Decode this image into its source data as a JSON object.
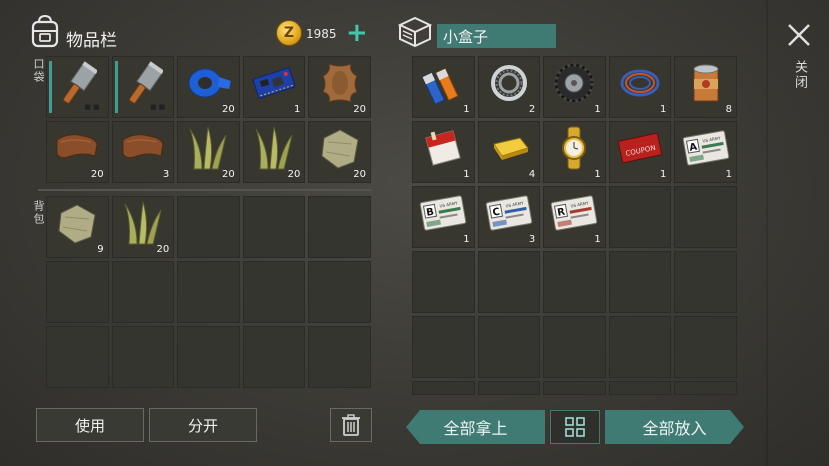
{
  "inventory": {
    "title": "物品栏",
    "coin_symbol": "Z",
    "coins": "1985",
    "add_symbol": "+",
    "pocket_label": "口袋",
    "backpack_label": "背包",
    "pocket": [
      {
        "item": "cleaver-icon",
        "count": "",
        "selected": true
      },
      {
        "item": "cleaver-icon",
        "count": "",
        "selected": true
      },
      {
        "item": "duct-tape-icon",
        "count": "20"
      },
      {
        "item": "circuit-board-icon",
        "count": "1"
      },
      {
        "item": "animal-hide-icon",
        "count": "20"
      },
      {
        "item": "leather-icon",
        "count": "20"
      },
      {
        "item": "leather-icon",
        "count": "3"
      },
      {
        "item": "plant-fiber-icon",
        "count": "20"
      },
      {
        "item": "plant-fiber-icon",
        "count": "20"
      },
      {
        "item": "cloth-icon",
        "count": "20"
      }
    ],
    "backpack": [
      {
        "item": "cloth-icon",
        "count": "9"
      },
      {
        "item": "plant-fiber-icon",
        "count": "20"
      },
      {},
      {},
      {},
      {},
      {},
      {},
      {},
      {},
      {},
      {},
      {},
      {},
      {}
    ],
    "use_label": "使用",
    "split_label": "分开"
  },
  "container": {
    "title": "小盒子",
    "slots": [
      {
        "item": "batteries-icon",
        "count": "1"
      },
      {
        "item": "bearing-icon",
        "count": "2"
      },
      {
        "item": "tire-icon",
        "count": "1"
      },
      {
        "item": "wire-coil-icon",
        "count": "1"
      },
      {
        "item": "tin-can-icon",
        "count": "8"
      },
      {
        "item": "cigarettes-icon",
        "count": "1"
      },
      {
        "item": "gold-bar-icon",
        "count": "4"
      },
      {
        "item": "gold-watch-icon",
        "count": "1"
      },
      {
        "item": "coupon-icon",
        "count": "1"
      },
      {
        "item": "army-card-a-icon",
        "count": "1"
      },
      {
        "item": "army-card-b-icon",
        "count": "1"
      },
      {
        "item": "army-card-c-icon",
        "count": "3"
      },
      {
        "item": "army-card-r-icon",
        "count": "1"
      },
      {},
      {},
      {},
      {},
      {},
      {},
      {},
      {},
      {},
      {},
      {},
      {},
      {},
      {},
      {},
      {},
      {}
    ],
    "take_all_label": "全部拿上",
    "put_all_label": "全部放入"
  },
  "coupon_text": "COUPON",
  "card_header": "US ARMY",
  "close_label": "关闭",
  "colors": {
    "accent": "#3f7a73",
    "coin": "#e0a51e",
    "plus": "#43c5a7"
  }
}
